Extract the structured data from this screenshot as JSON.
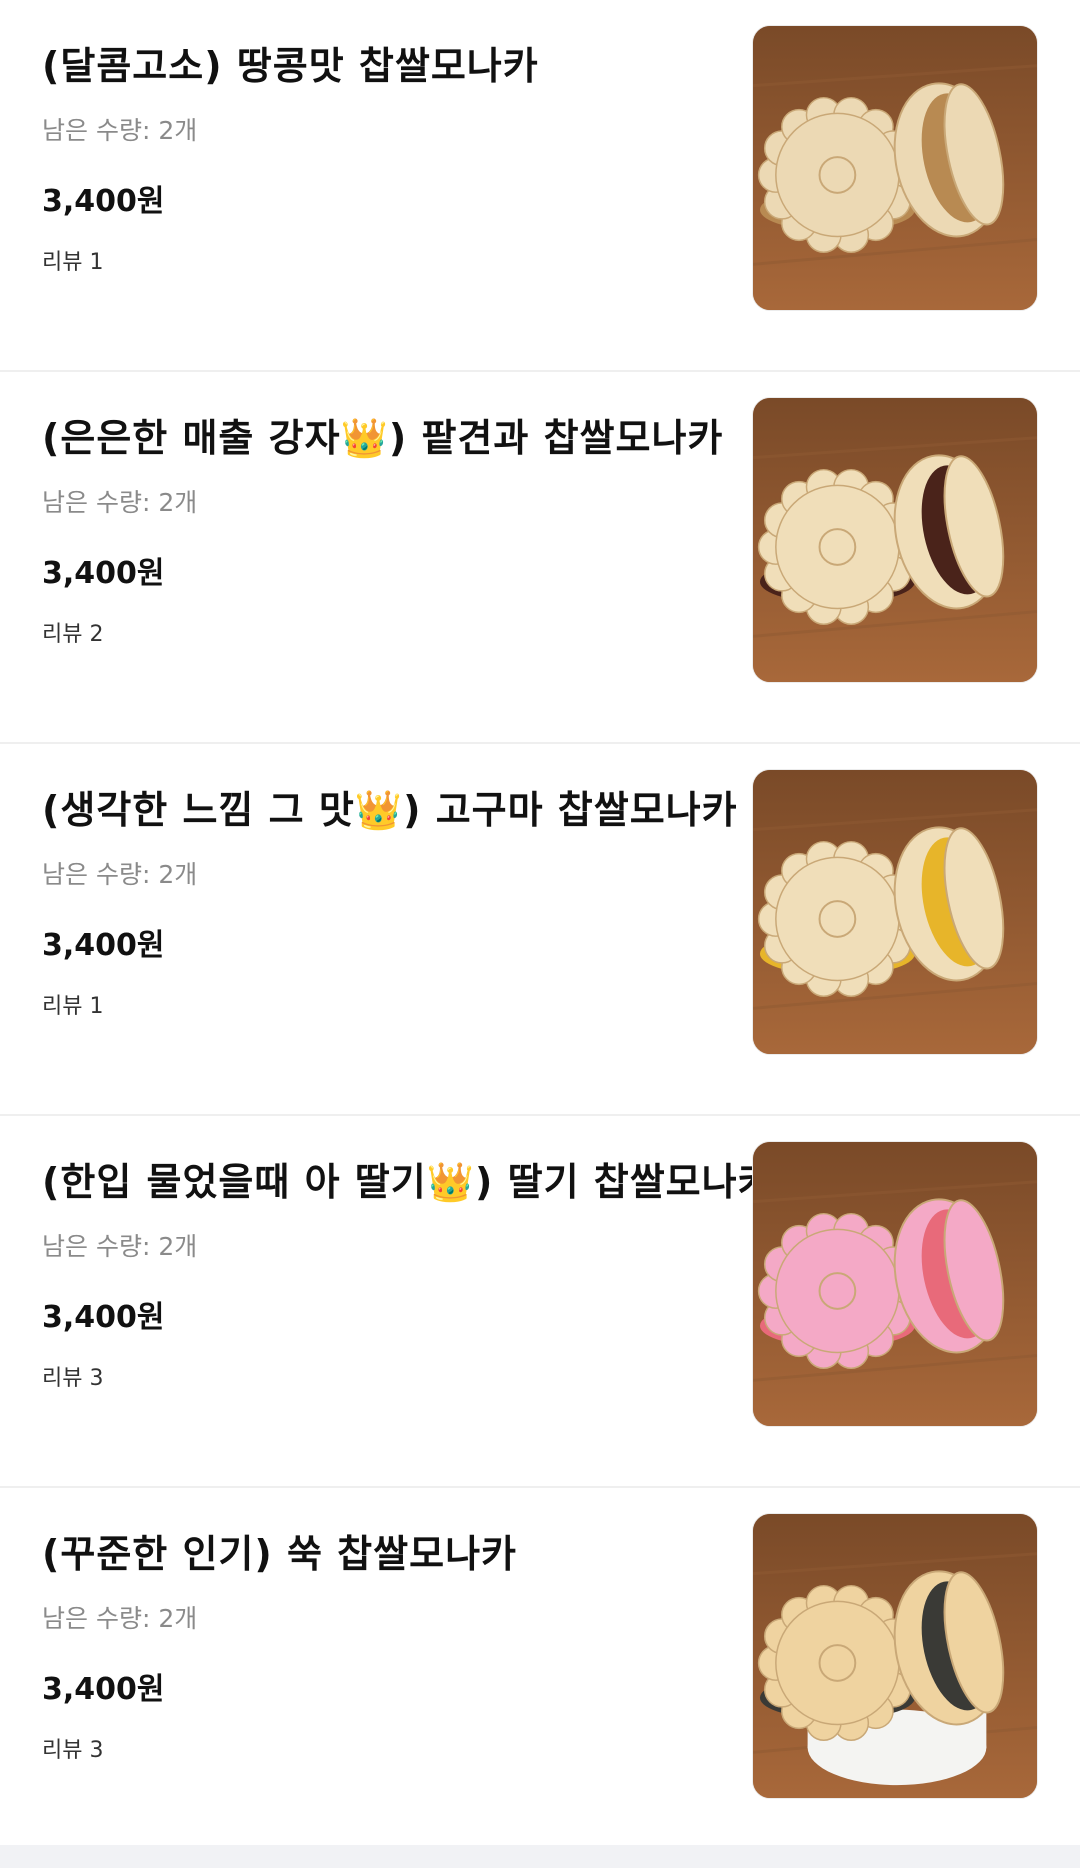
{
  "menu": {
    "items": [
      {
        "name": "(달콤고소) 땅콩맛 찹쌀모나카",
        "stock": "남은 수량: 2개",
        "price": "3,400원",
        "review": "리뷰 1",
        "image_icon": "peanut-monaka-image",
        "shell_color": "#ecd9b4",
        "filling_color": "#b88a52"
      },
      {
        "name": "(은은한 매출 강자👑) 팥견과 찹쌀모나카",
        "stock": "남은 수량: 2개",
        "price": "3,400원",
        "review": "리뷰 2",
        "image_icon": "redbean-monaka-image",
        "shell_color": "#f0deb9",
        "filling_color": "#4a231a"
      },
      {
        "name": "(생각한 느낌 그 맛👑) 고구마 찹쌀모나카",
        "stock": "남은 수량: 2개",
        "price": "3,400원",
        "review": "리뷰 1",
        "image_icon": "sweetpotato-monaka-image",
        "shell_color": "#f0deb9",
        "filling_color": "#e7b52a"
      },
      {
        "name": "(한입 물었을때 아 딸기👑) 딸기 찹쌀모나카",
        "stock": "남은 수량: 2개",
        "price": "3,400원",
        "review": "리뷰 3",
        "image_icon": "strawberry-monaka-image",
        "shell_color": "#f4a9c6",
        "filling_color": "#e86a7a"
      },
      {
        "name": "(꾸준한 인기) 쑥 찹쌀모나카",
        "stock": "남은 수량: 2개",
        "price": "3,400원",
        "review": "리뷰 3",
        "image_icon": "mugwort-monaka-image",
        "shell_color": "#efd3a0",
        "filling_color": "#3a3a36"
      }
    ]
  },
  "colors": {
    "background": "#ffffff",
    "divider": "#efefef",
    "text_primary": "#111111",
    "text_secondary": "#8a8a8a",
    "wood": "#a8683a"
  }
}
